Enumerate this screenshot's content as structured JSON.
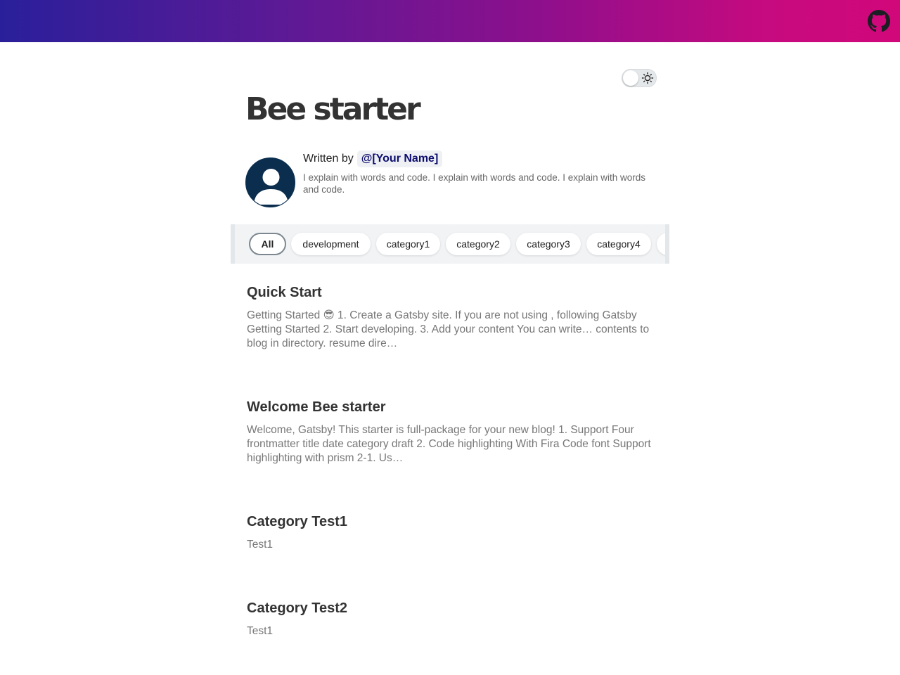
{
  "blog": {
    "title": "Bee starter"
  },
  "author": {
    "written_by": "Written by",
    "name": "@[Your Name]",
    "bio": "I explain with words and code. I explain with words and code. I explain with words and code."
  },
  "categories": [
    "All",
    "development",
    "category1",
    "category2",
    "category3",
    "category4"
  ],
  "posts": [
    {
      "title": "Quick Start",
      "excerpt": "Getting Started 😎 1. Create a Gatsby site. If you are not using , following Gatsby Getting Started 2. Start developing. 3. Add your content You can write… contents to blog in directory. resume dire…"
    },
    {
      "title": "Welcome Bee starter",
      "excerpt": "Welcome, Gatsby! This starter is full-package for your new blog! 1. Support Four frontmatter title date category draft 2. Code highlighting With Fira Code font Support highlighting with prism 2-1. Us…"
    },
    {
      "title": "Category Test1",
      "excerpt": "Test1"
    },
    {
      "title": "Category Test2",
      "excerpt": "Test1"
    }
  ],
  "icons": {
    "github": "github-icon",
    "theme": "sun-icon",
    "avatar": "user-icon"
  },
  "colors": {
    "gradient_start": "#2a1f9a",
    "gradient_end": "#d1087a",
    "author_name": "#0e0e6e"
  }
}
